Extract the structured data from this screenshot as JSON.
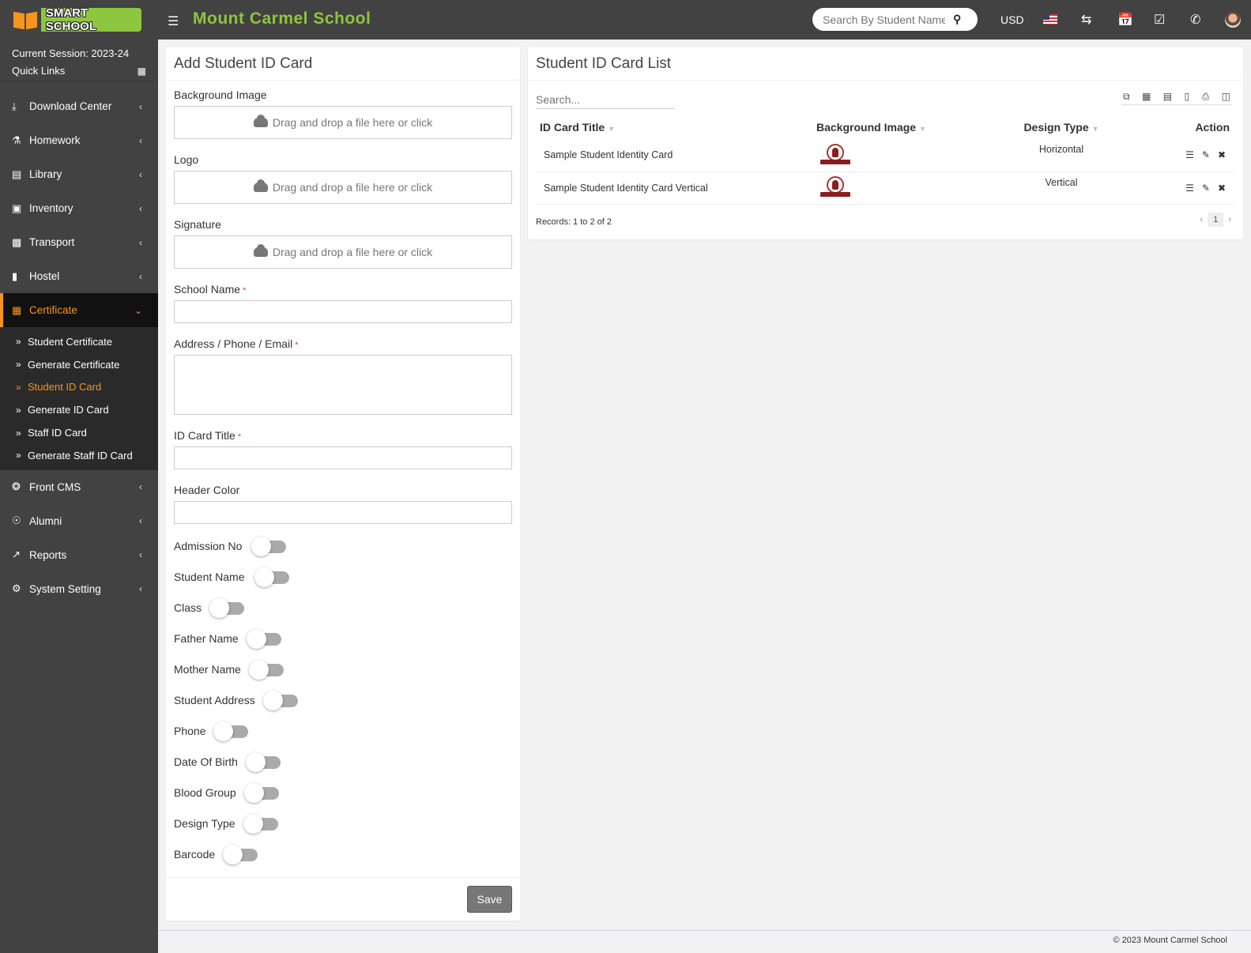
{
  "header": {
    "logo_text": "SMART SCHOOL",
    "school_name": "Mount Carmel School",
    "search_placeholder": "Search By Student Name",
    "currency": "USD",
    "icons": [
      "menu-icon",
      "search-icon",
      "us-flag-icon",
      "exchange-icon",
      "calendar-icon",
      "check-square-icon",
      "whatsapp-icon",
      "user-avatar"
    ]
  },
  "sidebar": {
    "session": "Current Session: 2023-24",
    "quick_links": "Quick Links",
    "items": [
      {
        "label": "Download Center",
        "icon": "download-icon"
      },
      {
        "label": "Homework",
        "icon": "flask-icon"
      },
      {
        "label": "Library",
        "icon": "book-icon"
      },
      {
        "label": "Inventory",
        "icon": "inventory-icon"
      },
      {
        "label": "Transport",
        "icon": "bus-icon"
      },
      {
        "label": "Hostel",
        "icon": "building-icon"
      },
      {
        "label": "Certificate",
        "icon": "certificate-icon",
        "active": true
      },
      {
        "label": "Front CMS",
        "icon": "cms-icon"
      },
      {
        "label": "Alumni",
        "icon": "alumni-icon"
      },
      {
        "label": "Reports",
        "icon": "chart-line-icon"
      },
      {
        "label": "System Setting",
        "icon": "gears-icon"
      }
    ],
    "certificate_sub": [
      {
        "label": "Student Certificate"
      },
      {
        "label": "Generate Certificate"
      },
      {
        "label": "Student ID Card",
        "active": true
      },
      {
        "label": "Generate ID Card"
      },
      {
        "label": "Staff ID Card"
      },
      {
        "label": "Generate Staff ID Card"
      }
    ]
  },
  "form": {
    "title": "Add Student ID Card",
    "dropzone_text": "Drag and drop a file here or click",
    "background_image_label": "Background Image",
    "logo_label": "Logo",
    "signature_label": "Signature",
    "school_name_label": "School Name",
    "address_label": "Address / Phone / Email",
    "id_card_title_label": "ID Card Title",
    "header_color_label": "Header Color",
    "required_mark": "*",
    "school_name_value": "",
    "address_value": "",
    "id_card_title_value": "",
    "header_color_value": "",
    "toggles": [
      {
        "label": "Admission No",
        "on": false
      },
      {
        "label": "Student Name",
        "on": false
      },
      {
        "label": "Class",
        "on": false
      },
      {
        "label": "Father Name",
        "on": false
      },
      {
        "label": "Mother Name",
        "on": false
      },
      {
        "label": "Student Address",
        "on": false
      },
      {
        "label": "Phone",
        "on": false
      },
      {
        "label": "Date Of Birth",
        "on": false
      },
      {
        "label": "Blood Group",
        "on": false
      },
      {
        "label": "Design Type",
        "on": false
      },
      {
        "label": "Barcode",
        "on": false
      }
    ],
    "save_label": "Save"
  },
  "list": {
    "title": "Student ID Card List",
    "search_placeholder": "Search...",
    "tools": [
      "copy-icon",
      "excel-icon",
      "csv-icon",
      "pdf-icon",
      "print-icon",
      "columns-icon"
    ],
    "columns": [
      "ID Card Title",
      "Background Image",
      "Design Type",
      "Action"
    ],
    "rows": [
      {
        "title": "Sample Student Identity Card",
        "image": "school-emblem",
        "design_type": "Horizontal"
      },
      {
        "title": "Sample Student Identity Card Vertical",
        "image": "school-emblem",
        "design_type": "Vertical"
      }
    ],
    "records_text": "Records: 1 to 2 of 2",
    "current_page": "1"
  },
  "footer": {
    "copyright": "© 2023 Mount Carmel School"
  },
  "colors": {
    "brand_green": "#8dc63f",
    "accent_orange": "#f7941d",
    "topbar": "#424242"
  }
}
